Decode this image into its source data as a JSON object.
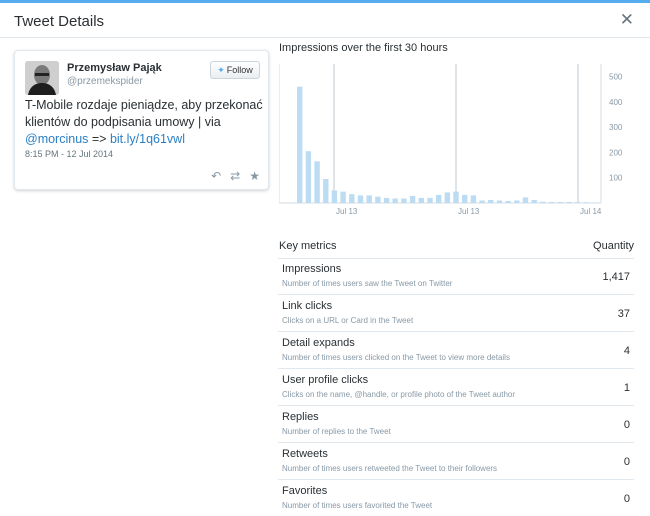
{
  "header": {
    "title": "Tweet Details",
    "close_label": "✕"
  },
  "tweet": {
    "author_name": "Przemysław Pająk",
    "handle": "@przemekspider",
    "follow_label": "Follow",
    "text_before": "T-Mobile rozdaje pieniądze, aby przekonać klientów do podpisania umowy | via ",
    "mention": "@morcinus",
    "arrow": " => ",
    "url": "bit.ly/1q61vwl",
    "timestamp": "8:15 PM - 12 Jul 2014",
    "actions": [
      "reply-icon",
      "retweet-icon",
      "favorite-icon"
    ]
  },
  "chart_data": {
    "type": "bar",
    "title": "Impressions over the first 30 hours",
    "y_ticks": [
      100,
      200,
      300,
      400,
      500
    ],
    "ylim": [
      0,
      550
    ],
    "x_tick_labels": [
      "Jul 13",
      "Jul 13",
      "Jul 14"
    ],
    "values": [
      460,
      205,
      165,
      95,
      50,
      45,
      35,
      30,
      30,
      25,
      20,
      18,
      18,
      28,
      20,
      20,
      32,
      42,
      45,
      32,
      30,
      10,
      12,
      10,
      8,
      10,
      22,
      12,
      5,
      4,
      4,
      4,
      3,
      3,
      2
    ],
    "bar_color": "#bcdcf3"
  },
  "metrics": {
    "header_left": "Key metrics",
    "header_right": "Quantity",
    "rows": [
      {
        "name": "Impressions",
        "desc": "Number of times users saw the Tweet on Twitter",
        "value": "1,417"
      },
      {
        "name": "Link clicks",
        "desc": "Clicks on a URL or Card in the Tweet",
        "value": "37"
      },
      {
        "name": "Detail expands",
        "desc": "Number of times users clicked on the Tweet to view more details",
        "value": "4"
      },
      {
        "name": "User profile clicks",
        "desc": "Clicks on the name, @handle, or profile photo of the Tweet author",
        "value": "1"
      },
      {
        "name": "Replies",
        "desc": "Number of replies to the Tweet",
        "value": "0"
      },
      {
        "name": "Retweets",
        "desc": "Number of times users retweeted the Tweet to their followers",
        "value": "0"
      },
      {
        "name": "Favorites",
        "desc": "Number of times users favorited the Tweet",
        "value": "0"
      }
    ]
  }
}
